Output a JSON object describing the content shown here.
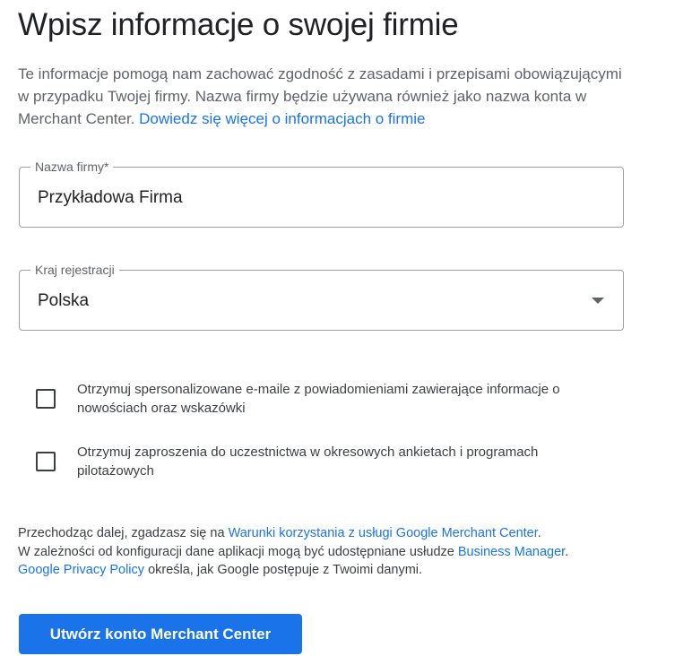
{
  "page": {
    "title": "Wpisz informacje o swojej firmie"
  },
  "intro": {
    "text": "Te informacje pomogą nam zachować zgodność z zasadami i przepisami obowiązującymi w przypadku Twojej firmy. Nazwa firmy będzie używana również jako nazwa konta w Merchant Center.",
    "link": "Dowiedz się więcej o informacjach o firmie"
  },
  "form": {
    "business_name": {
      "label": "Nazwa firmy*",
      "value": "Przykładowa Firma"
    },
    "country": {
      "label": "Kraj rejestracji",
      "value": "Polska",
      "icon": "dropdown-arrow-icon"
    }
  },
  "checkboxes": [
    {
      "label": "Otrzymuj spersonalizowane e-maile z powiadomieniami zawierające informacje o nowościach oraz wskazówki",
      "checked": false
    },
    {
      "label": "Otrzymuj zaproszenia do uczestnictwa w okresowych ankietach i programach pilotażowych",
      "checked": false
    }
  ],
  "legal": {
    "line1_prefix": "Przechodząc dalej, zgadzasz się na",
    "terms_link": "Warunki korzystania z usługi Google Merchant Center",
    "line1_suffix": ".",
    "line2_prefix": "W zależności od konfiguracji dane aplikacji mogą być udostępniane usłudze",
    "business_manager_link": "Business Manager",
    "line2_suffix": ".",
    "privacy_link": "Google Privacy Policy",
    "line3_suffix": "określa, jak Google postępuje z Twoimi danymi."
  },
  "actions": {
    "create_account_label": "Utwórz konto Merchant Center"
  },
  "colors": {
    "accent": "#1a73e8",
    "text": "#3c4043",
    "title": "#202124",
    "border": "#9aa0a6"
  }
}
